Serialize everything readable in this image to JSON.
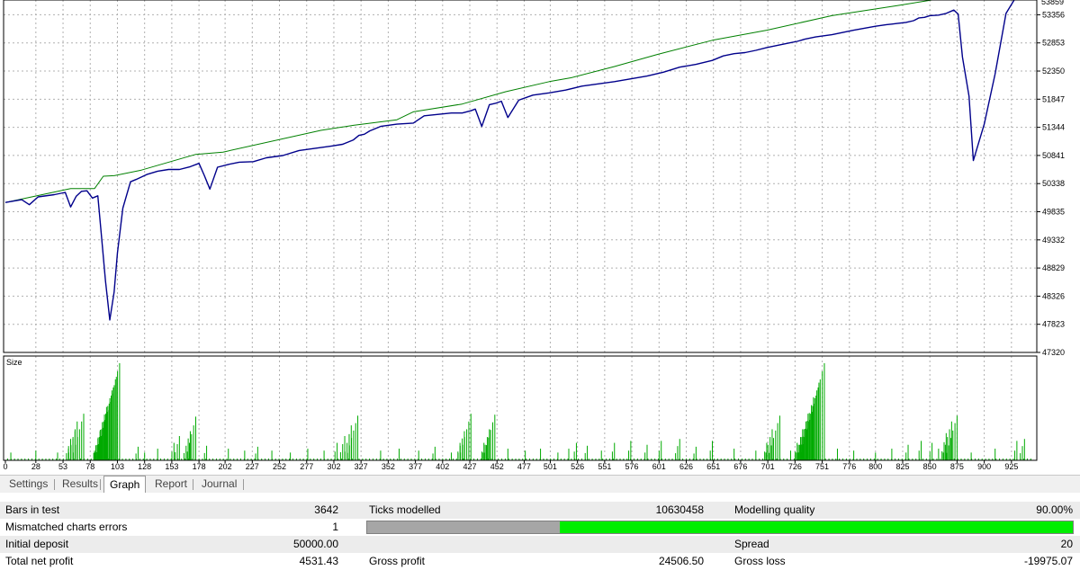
{
  "chart_data": [
    {
      "type": "line",
      "title": "",
      "series": [
        {
          "name": "",
          "role": "balance",
          "color": "#008000",
          "x": [
            0,
            60,
            82,
            90,
            100,
            125,
            175,
            200,
            290,
            320,
            360,
            375,
            420,
            460,
            500,
            520,
            560,
            600,
            650,
            700,
            760,
            820,
            855,
            870,
            878,
            900,
            920,
            940
          ],
          "y": [
            50000,
            50250,
            50250,
            50470,
            50480,
            50580,
            50860,
            50900,
            51290,
            51380,
            51480,
            51620,
            51760,
            51980,
            52160,
            52230,
            52430,
            52650,
            52900,
            53080,
            53340,
            53520,
            53630,
            53650,
            53930,
            53930,
            54010,
            54110
          ]
        },
        {
          "name": "",
          "role": "equity",
          "color": "#00008b",
          "x": [
            0,
            15,
            22,
            30,
            45,
            55,
            60,
            65,
            70,
            75,
            80,
            85,
            88,
            92,
            96,
            100,
            103,
            108,
            115,
            120,
            130,
            140,
            150,
            160,
            170,
            178,
            183,
            188,
            195,
            205,
            215,
            228,
            240,
            255,
            270,
            285,
            300,
            310,
            320,
            325,
            330,
            335,
            345,
            360,
            375,
            385,
            395,
            410,
            420,
            428,
            432,
            438,
            445,
            450,
            456,
            462,
            472,
            485,
            500,
            515,
            530,
            545,
            560,
            575,
            590,
            605,
            620,
            635,
            650,
            660,
            670,
            680,
            690,
            700,
            710,
            720,
            728,
            735,
            745,
            760,
            780,
            800,
            810,
            815,
            820,
            828,
            835,
            840,
            845,
            850,
            858,
            865,
            872,
            876,
            880,
            886,
            890,
            900,
            910,
            920,
            930,
            940
          ],
          "y": [
            50000,
            50050,
            49960,
            50100,
            50140,
            50180,
            49920,
            50110,
            50200,
            50210,
            50080,
            50120,
            49480,
            48600,
            47900,
            48400,
            49100,
            49900,
            50370,
            50410,
            50500,
            50560,
            50590,
            50590,
            50640,
            50700,
            50480,
            50240,
            50630,
            50680,
            50720,
            50730,
            50800,
            50840,
            50930,
            50970,
            51010,
            51040,
            51120,
            51200,
            51220,
            51280,
            51360,
            51400,
            51420,
            51550,
            51570,
            51600,
            51600,
            51640,
            51670,
            51360,
            51750,
            51770,
            51810,
            51520,
            51830,
            51920,
            51960,
            52010,
            52080,
            52120,
            52160,
            52210,
            52260,
            52330,
            52420,
            52470,
            52540,
            52620,
            52660,
            52680,
            52720,
            52770,
            52810,
            52850,
            52880,
            52920,
            52960,
            53000,
            53080,
            53150,
            53180,
            53190,
            53200,
            53220,
            53250,
            53300,
            53310,
            53340,
            53350,
            53380,
            53440,
            53370,
            52600,
            51900,
            50750,
            51400,
            52300,
            53380,
            53700,
            53840
          ]
        }
      ],
      "ylim": [
        47320,
        53620
      ],
      "ytick_labels": [
        "53356",
        "52853",
        "52350",
        "51847",
        "51344",
        "50841",
        "50338",
        "49835",
        "49332",
        "48829",
        "48326",
        "47823",
        "47320"
      ]
    },
    {
      "type": "bar",
      "ylabel": "Size",
      "color": "#00aa00",
      "description_of_values": "position size per trade, relative 0-1",
      "peaks": [
        {
          "x": 5,
          "v": 0.08
        },
        {
          "x": 28,
          "v": 0.1
        },
        {
          "x": 48,
          "v": 0.08
        },
        {
          "x": 58,
          "v": 0.12
        },
        {
          "x": 60,
          "v": 0.22
        },
        {
          "x": 64,
          "v": 0.3
        },
        {
          "x": 66,
          "v": 0.4
        },
        {
          "x": 72,
          "v": 0.48
        },
        {
          "x": 82,
          "v": 0.1
        },
        {
          "x": 87,
          "v": 0.3
        },
        {
          "x": 93,
          "v": 0.55
        },
        {
          "x": 98,
          "v": 0.72
        },
        {
          "x": 102,
          "v": 0.86
        },
        {
          "x": 105,
          "v": 1.0
        },
        {
          "x": 122,
          "v": 0.14
        },
        {
          "x": 128,
          "v": 0.08
        },
        {
          "x": 140,
          "v": 0.12
        },
        {
          "x": 155,
          "v": 0.18
        },
        {
          "x": 160,
          "v": 0.25
        },
        {
          "x": 170,
          "v": 0.3
        },
        {
          "x": 175,
          "v": 0.45
        },
        {
          "x": 185,
          "v": 0.15
        },
        {
          "x": 205,
          "v": 0.12
        },
        {
          "x": 220,
          "v": 0.1
        },
        {
          "x": 232,
          "v": 0.14
        },
        {
          "x": 245,
          "v": 0.1
        },
        {
          "x": 262,
          "v": 0.08
        },
        {
          "x": 278,
          "v": 0.12
        },
        {
          "x": 293,
          "v": 0.1
        },
        {
          "x": 305,
          "v": 0.18
        },
        {
          "x": 312,
          "v": 0.25
        },
        {
          "x": 318,
          "v": 0.36
        },
        {
          "x": 324,
          "v": 0.46
        },
        {
          "x": 345,
          "v": 0.1
        },
        {
          "x": 362,
          "v": 0.12
        },
        {
          "x": 380,
          "v": 0.1
        },
        {
          "x": 395,
          "v": 0.14
        },
        {
          "x": 410,
          "v": 0.08
        },
        {
          "x": 418,
          "v": 0.18
        },
        {
          "x": 422,
          "v": 0.3
        },
        {
          "x": 428,
          "v": 0.48
        },
        {
          "x": 440,
          "v": 0.18
        },
        {
          "x": 445,
          "v": 0.32
        },
        {
          "x": 450,
          "v": 0.47
        },
        {
          "x": 462,
          "v": 0.12
        },
        {
          "x": 478,
          "v": 0.1
        },
        {
          "x": 492,
          "v": 0.12
        },
        {
          "x": 508,
          "v": 0.08
        },
        {
          "x": 518,
          "v": 0.12
        },
        {
          "x": 525,
          "v": 0.18
        },
        {
          "x": 535,
          "v": 0.15
        },
        {
          "x": 548,
          "v": 0.1
        },
        {
          "x": 560,
          "v": 0.18
        },
        {
          "x": 575,
          "v": 0.2
        },
        {
          "x": 590,
          "v": 0.16
        },
        {
          "x": 603,
          "v": 0.2
        },
        {
          "x": 620,
          "v": 0.22
        },
        {
          "x": 635,
          "v": 0.14
        },
        {
          "x": 650,
          "v": 0.2
        },
        {
          "x": 670,
          "v": 0.12
        },
        {
          "x": 690,
          "v": 0.1
        },
        {
          "x": 700,
          "v": 0.18
        },
        {
          "x": 705,
          "v": 0.32
        },
        {
          "x": 712,
          "v": 0.46
        },
        {
          "x": 722,
          "v": 0.1
        },
        {
          "x": 728,
          "v": 0.18
        },
        {
          "x": 733,
          "v": 0.32
        },
        {
          "x": 738,
          "v": 0.48
        },
        {
          "x": 743,
          "v": 0.65
        },
        {
          "x": 748,
          "v": 0.8
        },
        {
          "x": 753,
          "v": 1.0
        },
        {
          "x": 765,
          "v": 0.12
        },
        {
          "x": 780,
          "v": 0.1
        },
        {
          "x": 800,
          "v": 0.08
        },
        {
          "x": 815,
          "v": 0.12
        },
        {
          "x": 830,
          "v": 0.16
        },
        {
          "x": 842,
          "v": 0.2
        },
        {
          "x": 852,
          "v": 0.18
        },
        {
          "x": 858,
          "v": 0.12
        },
        {
          "x": 865,
          "v": 0.28
        },
        {
          "x": 870,
          "v": 0.4
        },
        {
          "x": 875,
          "v": 0.46
        },
        {
          "x": 888,
          "v": 0.08
        },
        {
          "x": 910,
          "v": 0.12
        },
        {
          "x": 930,
          "v": 0.2
        },
        {
          "x": 937,
          "v": 0.22
        }
      ]
    }
  ],
  "x_axis": {
    "range": [
      0,
      945
    ],
    "tick_labels": [
      "0",
      "28",
      "53",
      "78",
      "103",
      "128",
      "153",
      "178",
      "202",
      "227",
      "252",
      "277",
      "302",
      "327",
      "352",
      "377",
      "402",
      "427",
      "452",
      "477",
      "501",
      "526",
      "551",
      "576",
      "601",
      "626",
      "651",
      "676",
      "701",
      "726",
      "751",
      "776",
      "800",
      "825",
      "850",
      "875",
      "900",
      "925"
    ]
  },
  "top_partial_label": "53859",
  "tabs": [
    {
      "label": "Settings",
      "active": false
    },
    {
      "label": "Results",
      "active": false
    },
    {
      "label": "Graph",
      "active": true
    },
    {
      "label": "Report",
      "active": false
    },
    {
      "label": "Journal",
      "active": false
    }
  ],
  "report": {
    "bars_in_test_label": "Bars in test",
    "bars_in_test": "3642",
    "ticks_modelled_label": "Ticks modelled",
    "ticks_modelled": "10630458",
    "modelling_quality_label": "Modelling quality",
    "modelling_quality": "90.00%",
    "modelling_quality_fraction": 0.9,
    "mismatched_label": "Mismatched charts errors",
    "mismatched": "1",
    "initial_deposit_label": "Initial deposit",
    "initial_deposit": "50000.00",
    "spread_label": "Spread",
    "spread": "20",
    "total_net_profit_label": "Total net profit",
    "total_net_profit": "4531.43",
    "gross_profit_label": "Gross profit",
    "gross_profit": "24506.50",
    "gross_loss_label": "Gross loss",
    "gross_loss": "-19975.07"
  },
  "colors": {
    "balance": "#008000",
    "equity": "#00008b",
    "size_bars": "#00aa00",
    "quality_bar": "#00ee00",
    "quality_bar_gray": "#a6a6a6"
  }
}
